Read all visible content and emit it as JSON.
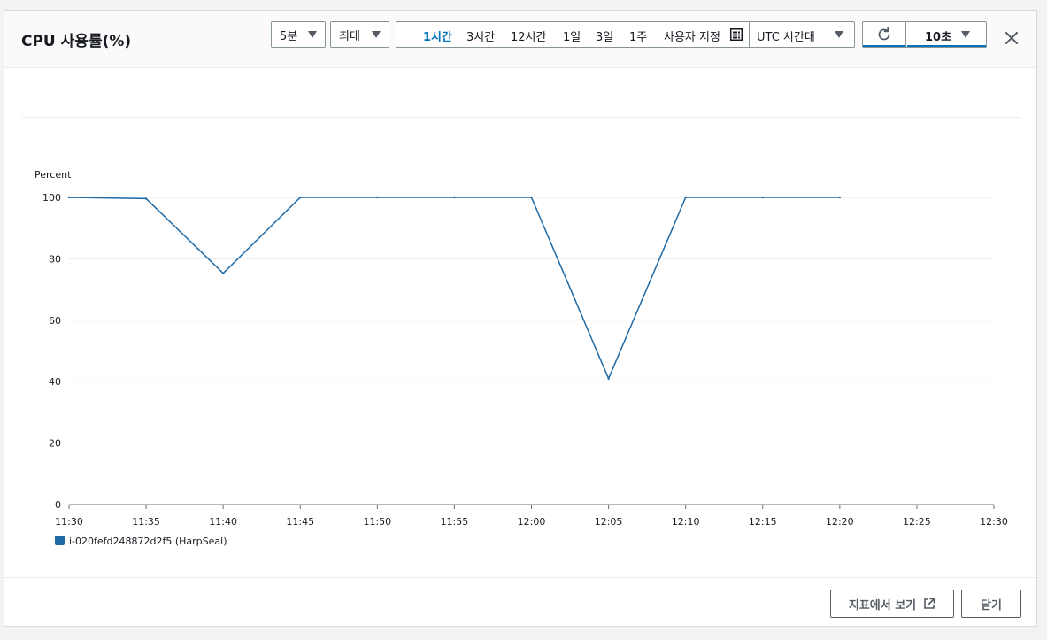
{
  "header": {
    "title": "CPU 사용률(%)",
    "period": "5분",
    "statistic": "최대",
    "ranges": [
      "1시간",
      "3시간",
      "12시간",
      "1일",
      "3일",
      "1주",
      "사용자 지정"
    ],
    "active_range": "1시간",
    "timezone": "UTC 시간대",
    "refresh_interval": "10초"
  },
  "footer": {
    "view_metrics": "지표에서 보기",
    "close": "닫기"
  },
  "icons": {
    "calendar": "calendar-icon",
    "refresh": "refresh-icon",
    "close": "close-icon",
    "external": "external-link-icon"
  },
  "colors": {
    "series": "#1f6aa5",
    "active": "#0073bb"
  },
  "chart_data": {
    "type": "line",
    "title": "",
    "ylabel": "Percent",
    "xlabel": "",
    "x_ticks": [
      "11:30",
      "11:35",
      "11:40",
      "11:45",
      "11:50",
      "11:55",
      "12:00",
      "12:05",
      "12:10",
      "12:15",
      "12:20",
      "12:25",
      "12:30"
    ],
    "y_ticks": [
      0,
      20,
      40,
      60,
      80,
      100
    ],
    "ylim": [
      0,
      100
    ],
    "grid": true,
    "legend_position": "bottom-left",
    "series": [
      {
        "name": "i-020fefd248872d2f5 (HarpSeal)",
        "x": [
          "11:30",
          "11:35",
          "11:40",
          "11:45",
          "11:50",
          "11:55",
          "12:00",
          "12:05",
          "12:10",
          "12:15",
          "12:20"
        ],
        "values": [
          100,
          99.6,
          75.3,
          100,
          100,
          100,
          100,
          41,
          100,
          100,
          100
        ]
      }
    ]
  }
}
